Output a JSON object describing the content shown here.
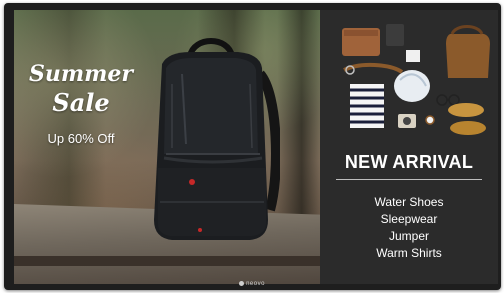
{
  "promo": {
    "headline_line1": "Summer",
    "headline_line2": "Sale",
    "discount": "Up 60% Off"
  },
  "panel": {
    "title": "NEW ARRIVAL",
    "items": [
      "Water Shoes",
      "Sleepwear",
      "Jumper",
      "Warm Shirts"
    ]
  },
  "brand": {
    "name": "neovo"
  },
  "colors": {
    "frame": "#1e1e1e",
    "panel": "#2b2b2b",
    "text": "#ffffff"
  }
}
